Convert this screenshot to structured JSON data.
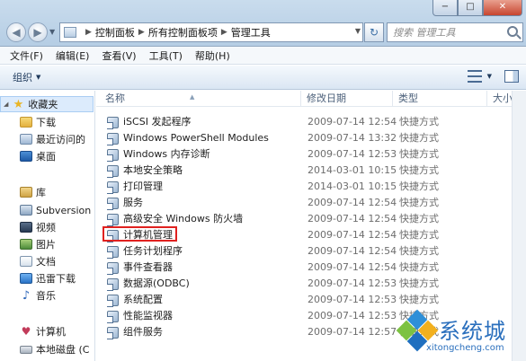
{
  "window": {
    "minimize": "−",
    "maximize": "□",
    "close": "✕"
  },
  "address": {
    "crumbs": [
      "控制面板",
      "所有控制面板项",
      "管理工具"
    ]
  },
  "search": {
    "placeholder": "搜索 管理工具"
  },
  "menu": {
    "items": [
      "文件(F)",
      "编辑(E)",
      "查看(V)",
      "工具(T)",
      "帮助(H)"
    ]
  },
  "toolbar": {
    "organize": "组织"
  },
  "nav": {
    "favorites": "收藏夹",
    "downloads": "下载",
    "recent": "最近访问的",
    "desktop": "桌面",
    "libraries": "库",
    "subversion": "Subversion",
    "videos": "视频",
    "pictures": "图片",
    "documents": "文档",
    "thunder": "迅雷下载",
    "music": "音乐",
    "computer": "计算机",
    "local_disk": "本地磁盘 (C"
  },
  "columns": {
    "name": "名称",
    "date": "修改日期",
    "type": "类型",
    "size": "大小"
  },
  "files": [
    {
      "name": "iSCSI 发起程序",
      "date": "2009-07-14 12:54",
      "type": "快捷方式"
    },
    {
      "name": "Windows PowerShell Modules",
      "date": "2009-07-14 13:32",
      "type": "快捷方式"
    },
    {
      "name": "Windows 内存诊断",
      "date": "2009-07-14 12:53",
      "type": "快捷方式"
    },
    {
      "name": "本地安全策略",
      "date": "2014-03-01 10:15",
      "type": "快捷方式"
    },
    {
      "name": "打印管理",
      "date": "2014-03-01 10:15",
      "type": "快捷方式"
    },
    {
      "name": "服务",
      "date": "2009-07-14 12:54",
      "type": "快捷方式"
    },
    {
      "name": "高级安全 Windows 防火墙",
      "date": "2009-07-14 12:54",
      "type": "快捷方式"
    },
    {
      "name": "计算机管理",
      "date": "2009-07-14 12:54",
      "type": "快捷方式"
    },
    {
      "name": "任务计划程序",
      "date": "2009-07-14 12:54",
      "type": "快捷方式"
    },
    {
      "name": "事件查看器",
      "date": "2009-07-14 12:54",
      "type": "快捷方式"
    },
    {
      "name": "数据源(ODBC)",
      "date": "2009-07-14 12:53",
      "type": "快捷方式"
    },
    {
      "name": "系统配置",
      "date": "2009-07-14 12:53",
      "type": "快捷方式"
    },
    {
      "name": "性能监视器",
      "date": "2009-07-14 12:53",
      "type": "快捷方式"
    },
    {
      "name": "组件服务",
      "date": "2009-07-14 12:57",
      "type": "快捷方式"
    }
  ],
  "watermark": {
    "brand": "系统城",
    "site": "xitongcheng.com"
  },
  "colors": {
    "highlight": "#e0211f",
    "accent": "#2a6fbd"
  }
}
